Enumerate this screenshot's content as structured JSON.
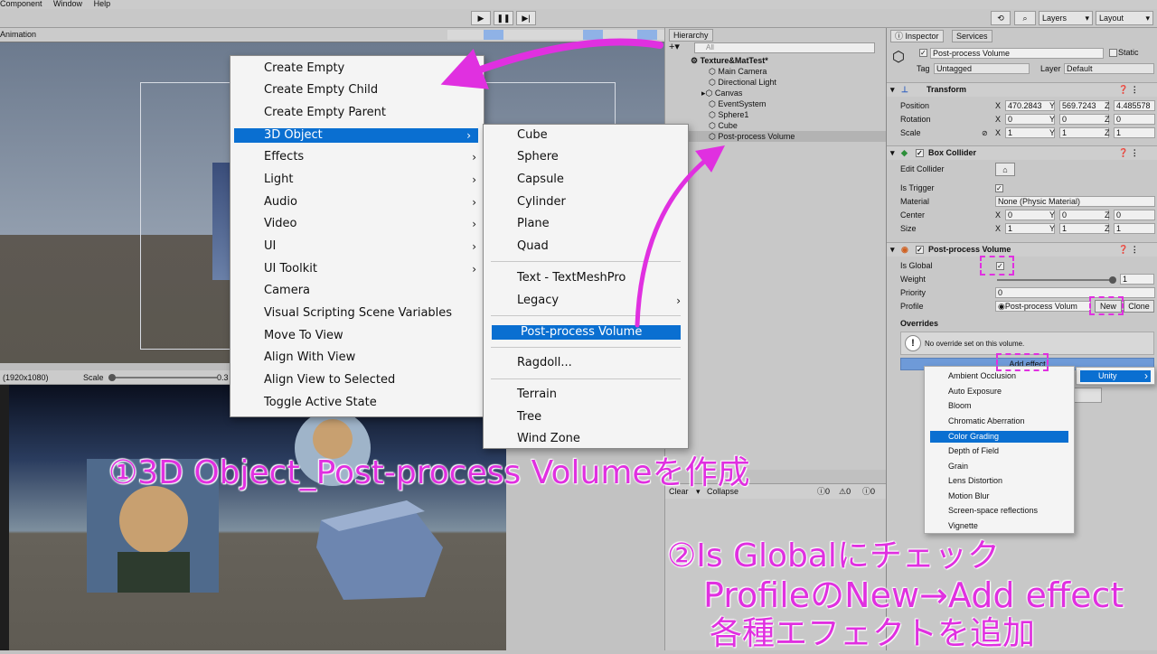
{
  "menubar": {
    "items": [
      "Component",
      "Window",
      "Help"
    ]
  },
  "toolbar": {
    "layers": "Layers",
    "layout": "Layout"
  },
  "scene": {
    "tab": "Animation"
  },
  "game": {
    "resolution": "(1920x1080)",
    "scale_label": "Scale",
    "scale_value": "0.3"
  },
  "hierarchy": {
    "title": "Hierarchy",
    "search_placeholder": "All",
    "scene_name": "Texture&MatTest*",
    "items": [
      "Main Camera",
      "Directional Light",
      "Canvas",
      "EventSystem",
      "Sphere1",
      "Cube",
      "Post-process Volume"
    ]
  },
  "console": {
    "clear": "Clear",
    "collapse": "Collapse",
    "errors": "0",
    "warnings": "0",
    "logs": "0"
  },
  "inspector": {
    "tabs": [
      "Inspector",
      "Services"
    ],
    "object_name": "Post-process Volume",
    "static_label": "Static",
    "tag_label": "Tag",
    "tag_value": "Untagged",
    "layer_label": "Layer",
    "layer_value": "Default",
    "transform": {
      "title": "Transform",
      "labels": [
        "Position",
        "Rotation",
        "Scale"
      ],
      "position": [
        "470.2843",
        "569.7243",
        "4.485578"
      ],
      "rotation": [
        "0",
        "0",
        "0"
      ],
      "scale": [
        "1",
        "1",
        "1"
      ]
    },
    "box_collider": {
      "title": "Box Collider",
      "edit_label": "Edit Collider",
      "trigger_label": "Is Trigger",
      "material_label": "Material",
      "material_value": "None (Physic Material)",
      "center_label": "Center",
      "center": [
        "0",
        "0",
        "0"
      ],
      "size_label": "Size",
      "size": [
        "1",
        "1",
        "1"
      ]
    },
    "ppv": {
      "title": "Post-process Volume",
      "global_label": "Is Global",
      "weight_label": "Weight",
      "weight_value": "1",
      "priority_label": "Priority",
      "priority_value": "0",
      "profile_label": "Profile",
      "profile_value": "Post-process Volum",
      "new_label": "New",
      "clone_label": "Clone",
      "overrides_label": "Overrides",
      "no_override": "No override set on this volume.",
      "add_effect": "Add effect"
    }
  },
  "context_menu": {
    "items": [
      "Create Empty",
      "Create Empty Child",
      "Create Empty Parent",
      "3D Object",
      "Effects",
      "Light",
      "Audio",
      "Video",
      "UI",
      "UI Toolkit",
      "Camera",
      "Visual Scripting Scene Variables",
      "Move To View",
      "Align With View",
      "Align View to Selected",
      "Toggle Active State"
    ],
    "selected": "3D Object"
  },
  "submenu_3d": {
    "items": [
      "Cube",
      "Sphere",
      "Capsule",
      "Cylinder",
      "Plane",
      "Quad",
      "Text - TextMeshPro",
      "Legacy",
      "Post-process Volume",
      "Ragdoll...",
      "Terrain",
      "Tree",
      "Wind Zone"
    ],
    "selected": "Post-process Volume"
  },
  "effect_menu": {
    "category": "Unity",
    "items": [
      "Ambient Occlusion",
      "Auto Exposure",
      "Bloom",
      "Chromatic Aberration",
      "Color Grading",
      "Depth of Field",
      "Grain",
      "Lens Distortion",
      "Motion Blur",
      "Screen-space reflections",
      "Vignette"
    ],
    "selected": "Color Grading"
  },
  "annotations": {
    "step1": "①3D Object_Post-process Volumeを作成",
    "step2_line1": "②Is Globalにチェック",
    "step2_line2": "ProfileのNew→Add effect",
    "step2_line3": "各種エフェクトを追加"
  },
  "colors": {
    "accent": "#e030e0",
    "selection": "#0a6fd1"
  }
}
